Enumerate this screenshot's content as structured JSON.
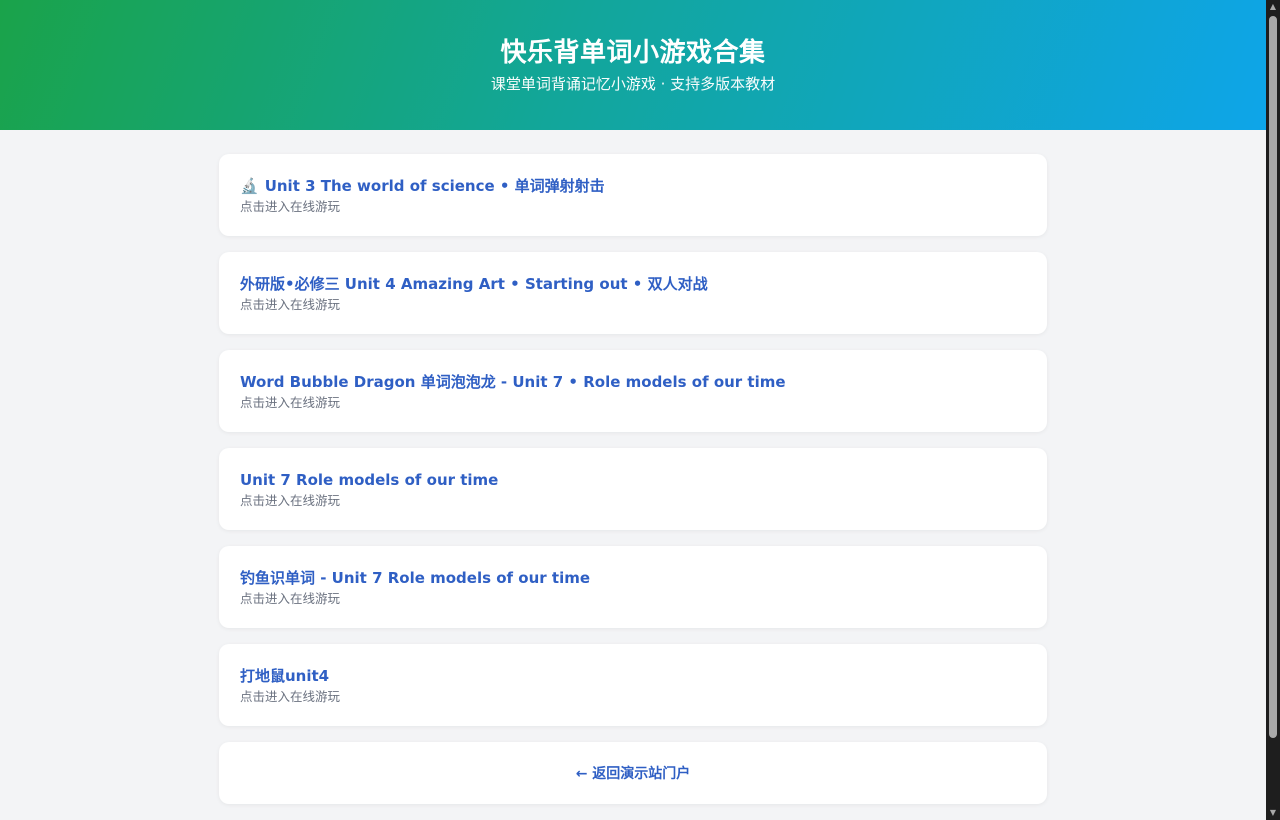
{
  "header": {
    "title": "快乐背单词小游戏合集",
    "subtitle": "课堂单词背诵记忆小游戏 · 支持多版本教材"
  },
  "games": [
    {
      "icon": "microscope-icon",
      "icon_glyph": "🔬",
      "title": "Unit 3 The world of science • 单词弹射射击",
      "subtitle": "点击进入在线游玩"
    },
    {
      "title": "外研版•必修三 Unit 4 Amazing Art • Starting out • 双人对战",
      "subtitle": "点击进入在线游玩"
    },
    {
      "title": "Word Bubble Dragon 单词泡泡龙 - Unit 7 • Role models of our time",
      "subtitle": "点击进入在线游玩"
    },
    {
      "title": "Unit 7 Role models of our time",
      "subtitle": "点击进入在线游玩"
    },
    {
      "title": "钓鱼识单词 - Unit 7 Role models of our time",
      "subtitle": "点击进入在线游玩"
    },
    {
      "title": "打地鼠unit4",
      "subtitle": "点击进入在线游玩"
    }
  ],
  "back_link": {
    "label": "← 返回演示站门户"
  },
  "colors": {
    "gradient_start": "#1aa34a",
    "gradient_end": "#0ea5e9",
    "link": "#2f5fc4",
    "page_bg": "#f3f4f6"
  }
}
